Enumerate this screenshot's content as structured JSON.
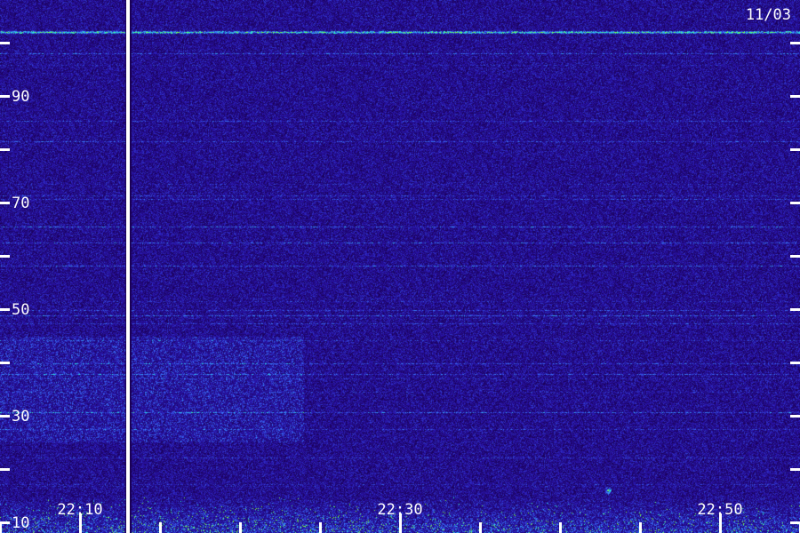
{
  "chart_data": {
    "type": "heatmap",
    "title": "",
    "date_label": "11/03",
    "xlabel": "",
    "ylabel": "",
    "x_tick_labels": [
      "22:10",
      "22:30",
      "22:50"
    ],
    "y_tick_labels": [
      "10",
      "30",
      "50",
      "70",
      "90"
    ],
    "y_major_ticks": [
      10,
      30,
      50,
      70,
      90
    ],
    "y_minor_ticks": [
      20,
      40,
      60,
      80,
      100
    ],
    "ylim": [
      8,
      108
    ],
    "xlim": [
      "22:05",
      "22:55"
    ],
    "x_major_ticks": [
      "22:10",
      "22:30",
      "22:50"
    ],
    "x_minor_ticks": [
      "22:05",
      "22:15",
      "22:20",
      "22:25",
      "22:35",
      "22:40",
      "22:45",
      "22:55"
    ],
    "data_gap_time": "22:13",
    "colors": {
      "background": "#1a0055",
      "low": "#2a16b0",
      "mid": "#3a7dff",
      "high": "#22ffd0",
      "peak": "#7dff3a",
      "label": "#ffffff"
    },
    "features": {
      "persistent_line_y": 102,
      "enhanced_band_y": [
        25,
        45
      ],
      "enhanced_band_until": "22:24",
      "strong_low_band_y": [
        8,
        15
      ],
      "isolated_spot": {
        "time": "22:43",
        "y": 16
      }
    }
  }
}
